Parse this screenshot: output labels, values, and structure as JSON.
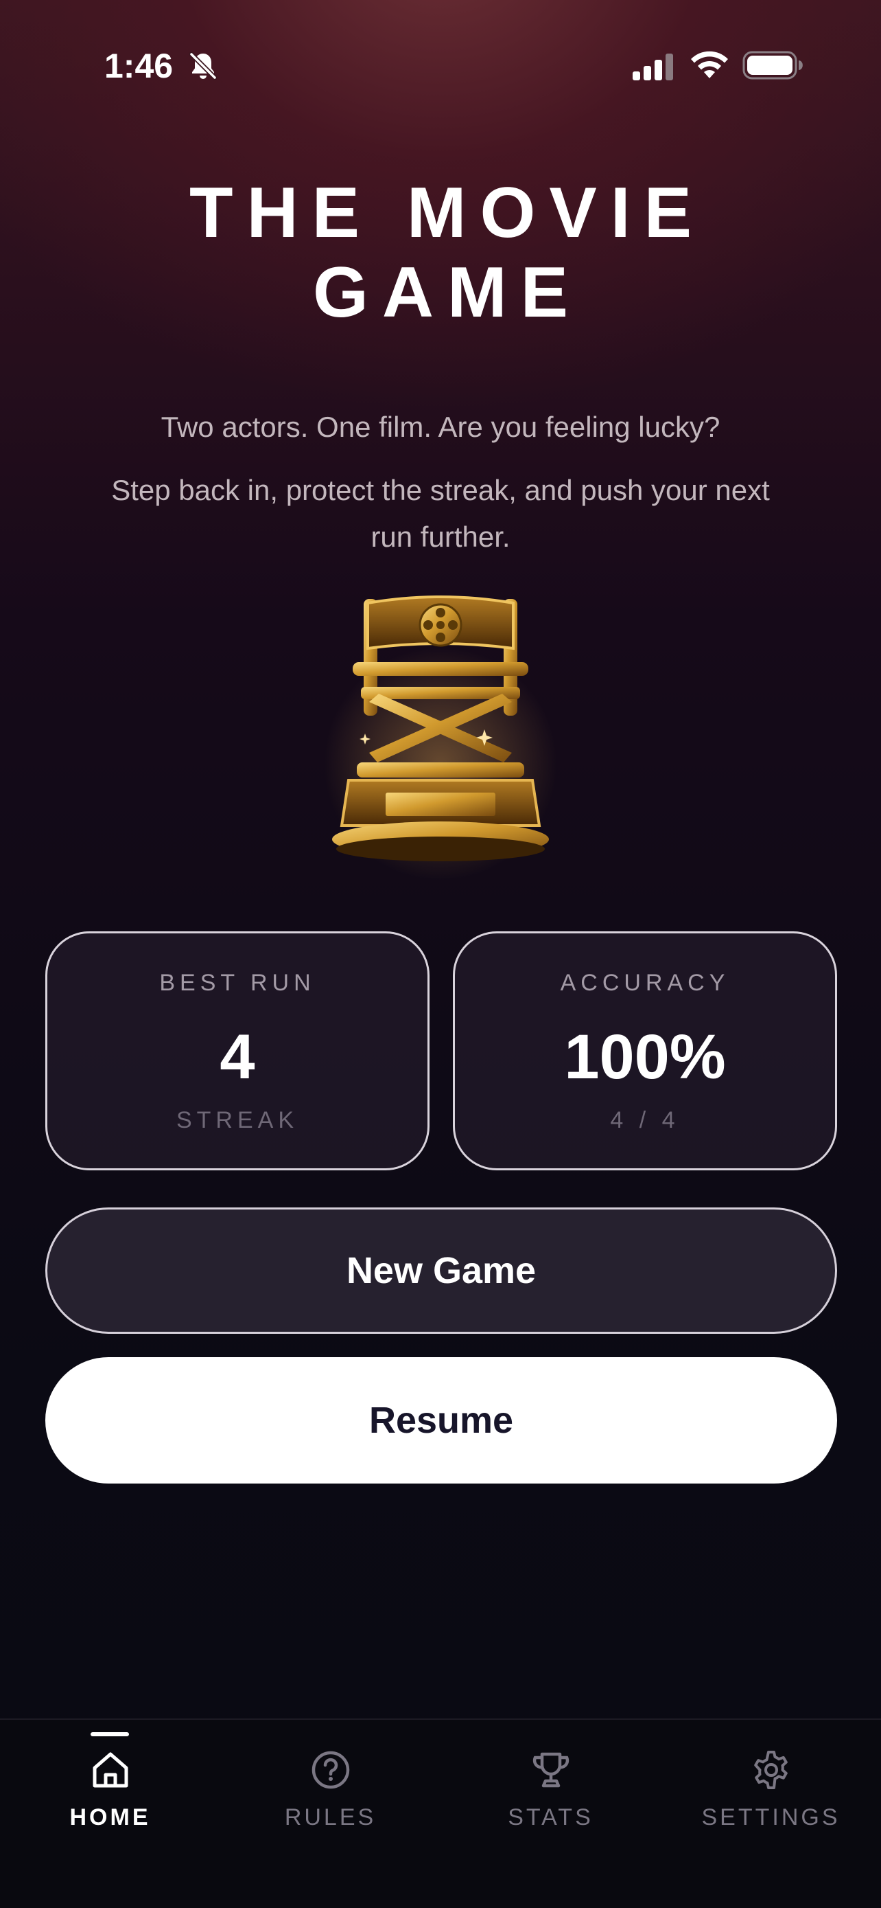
{
  "status_bar": {
    "time": "1:46",
    "icons": [
      "bell-slash-icon",
      "cellular-signal-icon",
      "wifi-icon",
      "battery-icon"
    ]
  },
  "header": {
    "title_line1": "THE MOVIE",
    "title_line2": "GAME",
    "subtitle": "Two actors. One film. Are you feeling lucky?",
    "tagline": "Step back in, protect the streak, and push your next run further."
  },
  "hero": {
    "icon": "directors-chair-trophy-icon"
  },
  "stats": {
    "best_run": {
      "label": "BEST RUN",
      "value": "4",
      "sub": "STREAK"
    },
    "accuracy": {
      "label": "ACCURACY",
      "value": "100%",
      "sub": "4 / 4"
    }
  },
  "actions": {
    "new_game_label": "New Game",
    "resume_label": "Resume"
  },
  "tab_bar": {
    "active": "HOME",
    "tabs": [
      {
        "label": "HOME",
        "icon": "home-icon"
      },
      {
        "label": "RULES",
        "icon": "question-circle-icon"
      },
      {
        "label": "STATS",
        "icon": "trophy-icon"
      },
      {
        "label": "SETTINGS",
        "icon": "gear-icon"
      }
    ]
  },
  "colors": {
    "background_top": "#3a1620",
    "background_bottom": "#0a0a12",
    "card_border": "#d9d3dc",
    "trophy_gold": "#d4a23a",
    "text_muted": "#c3b7bd",
    "resume_button_bg": "#ffffff",
    "resume_button_text": "#17152a"
  }
}
